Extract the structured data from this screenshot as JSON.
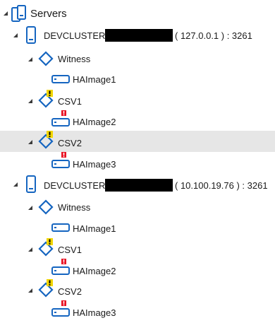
{
  "tree": {
    "root_label": "Servers",
    "clusters": [
      {
        "name": "DEVCLUSTER1",
        "address": "( 127.0.0.1 ) : 3261",
        "nodes": [
          {
            "label": "Witness",
            "warning": false,
            "image": "HAImage1",
            "image_error": false
          },
          {
            "label": "CSV1",
            "warning": true,
            "image": "HAImage2",
            "image_error": true
          },
          {
            "label": "CSV2",
            "warning": true,
            "image": "HAImage3",
            "image_error": true
          }
        ]
      },
      {
        "name": "DEVCLUSTER2",
        "address": "( 10.100.19.76 ) : 3261",
        "nodes": [
          {
            "label": "Witness",
            "warning": false,
            "image": "HAImage1",
            "image_error": false
          },
          {
            "label": "CSV1",
            "warning": true,
            "image": "HAImage2",
            "image_error": true
          },
          {
            "label": "CSV2",
            "warning": true,
            "image": "HAImage3",
            "image_error": true
          }
        ]
      }
    ]
  },
  "colors": {
    "accent": "#1565c0",
    "warning": "#f2d600",
    "error": "#e81123",
    "selection": "#e6e6e6"
  },
  "icons": {
    "root": "servers-icon",
    "cluster": "server-icon",
    "node": "diamond-node-icon",
    "image": "disk-image-icon"
  }
}
